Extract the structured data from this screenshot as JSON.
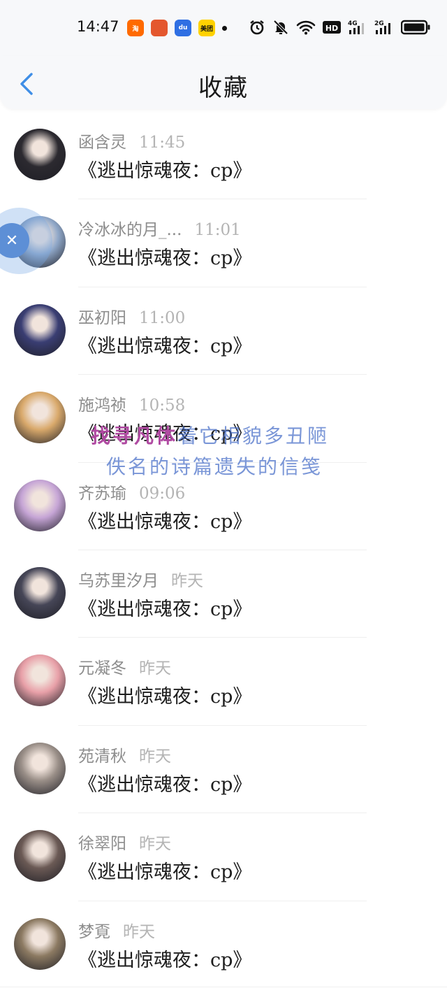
{
  "status": {
    "time": "14:47",
    "apps": [
      {
        "icon": "taobao-icon",
        "color": "#ff6a00",
        "text": "淘"
      },
      {
        "icon": "game-icon",
        "color": "#e4572e",
        "text": ""
      },
      {
        "icon": "baidu-icon",
        "color": "#2f6fe3",
        "text": "du"
      },
      {
        "icon": "meituan-icon",
        "color": "#ffd100",
        "text": "美团"
      }
    ],
    "network_labels": [
      "HD",
      "4G",
      "2G"
    ]
  },
  "nav": {
    "title": "收藏",
    "accent": "#3f8ee6"
  },
  "favorites": [
    {
      "name": "函含灵",
      "time": "11:45",
      "message": "《逃出惊魂夜：cp》",
      "avatar_color": "#2c2a30"
    },
    {
      "name": "冷冰冰的月_...",
      "time": "11:01",
      "message": "《逃出惊魂夜：cp》",
      "avatar_color": "#8fa7c8"
    },
    {
      "name": "巫初阳",
      "time": "11:00",
      "message": "《逃出惊魂夜：cp》",
      "avatar_color": "#3a3e73"
    },
    {
      "name": "施鸿祯",
      "time": "10:58",
      "message": "《逃出惊魂夜：cp》",
      "avatar_color": "#d9a96b"
    },
    {
      "name": "齐苏瑜",
      "time": "09:06",
      "message": "《逃出惊魂夜：cp》",
      "avatar_color": "#c6a5d6"
    },
    {
      "name": "乌苏里汐月",
      "time": "昨天",
      "message": "《逃出惊魂夜：cp》",
      "avatar_color": "#464657"
    },
    {
      "name": "元凝冬",
      "time": "昨天",
      "message": "《逃出惊魂夜：cp》",
      "avatar_color": "#e8a0a8"
    },
    {
      "name": "苑清秋",
      "time": "昨天",
      "message": "《逃出惊魂夜：cp》",
      "avatar_color": "#9a8f88"
    },
    {
      "name": "徐翠阳",
      "time": "昨天",
      "message": "《逃出惊魂夜：cp》",
      "avatar_color": "#6b5a55"
    },
    {
      "name": "梦覔",
      "time": "昨天",
      "message": "《逃出惊魂夜：cp》",
      "avatar_color": "#8c7a62"
    }
  ],
  "overlay": {
    "line1_highlight": "找寻凡体",
    "line1_rest": "着它相貌多丑陋",
    "line2": "佚名的诗篇遗失的信笺"
  },
  "floating_ball": {
    "icon": "close-x-icon",
    "glyph": "✕"
  }
}
